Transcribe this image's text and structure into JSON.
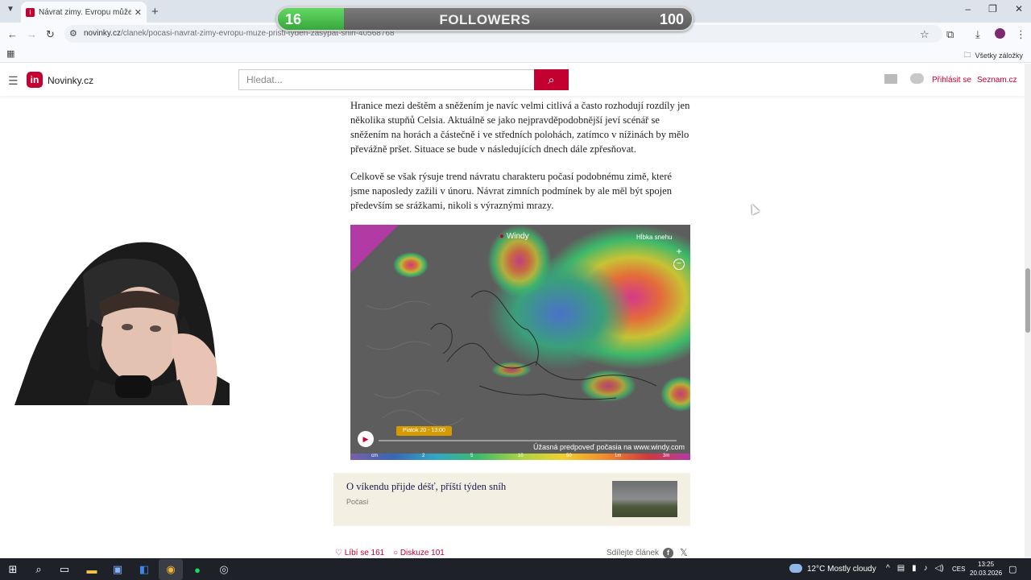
{
  "browser": {
    "tab_title": "Návrat zimy. Evropu může příšt",
    "new_tab": "+",
    "url_host": "novinky.cz",
    "url_path": "/clanek/pocasi-navrat-zimy-evropu-muze-pristi-tyden-zasypat-snih-40568768",
    "bookmarks_label": "Všetky záložky",
    "window_controls": [
      "–",
      "❐",
      "✕"
    ]
  },
  "overlay": {
    "followers_current": "16",
    "followers_label": "FOLLOWERS",
    "followers_goal": "100",
    "progress": 0.16,
    "fill_color": "#4bc34b"
  },
  "site": {
    "logo_letter": "in",
    "name": "Novinky.cz",
    "search_placeholder": "Hledat...",
    "login": "Přihlásit se",
    "seznam": "Seznam.cz",
    "brand_color": "#c3002f"
  },
  "article": {
    "paragraphs": [
      "Hranice mezi deštěm a sněžením je navíc velmi citlivá a často rozhodují rozdíly jen několika stupňů Celsia. Aktuálně se jako nejpravděpodobnější jeví scénář se sněžením na horách a částečně i ve středních polohách, zatímco v nížinách by mělo převážně pršet. Situace se bude v následujících dnech dále zpřesňovat.",
      "Celkově se však rýsuje trend návratu charakteru počasí podobnému zimě, které jsme naposledy zažili v únoru. Návrat zimních podmínek by ale měl být spojen především se srážkami, nikoli s výraznými mrazy."
    ],
    "map": {
      "brand": "Windy",
      "layer": "Hĺbka snehu",
      "zoom_in": "+",
      "zoom_out": "−",
      "time_label": "Piatok 20 - 13:00",
      "ad_text": "Úžasná predpoveď počasia na www.windy.com",
      "scale_labels": [
        "cm",
        "2",
        "5",
        "10",
        "50",
        "1m",
        "3m"
      ]
    },
    "related": {
      "title": "O víkendu přijde déšť, příští týden sníh",
      "category": "Počasí"
    },
    "likes": "Líbí se 161",
    "discussion": "Diskuze 101",
    "share": "Sdílejte článek"
  },
  "taskbar": {
    "weather": "12°C  Mostly cloudy",
    "lang": "CES",
    "time": "13:25",
    "date": "20.03.2026"
  }
}
